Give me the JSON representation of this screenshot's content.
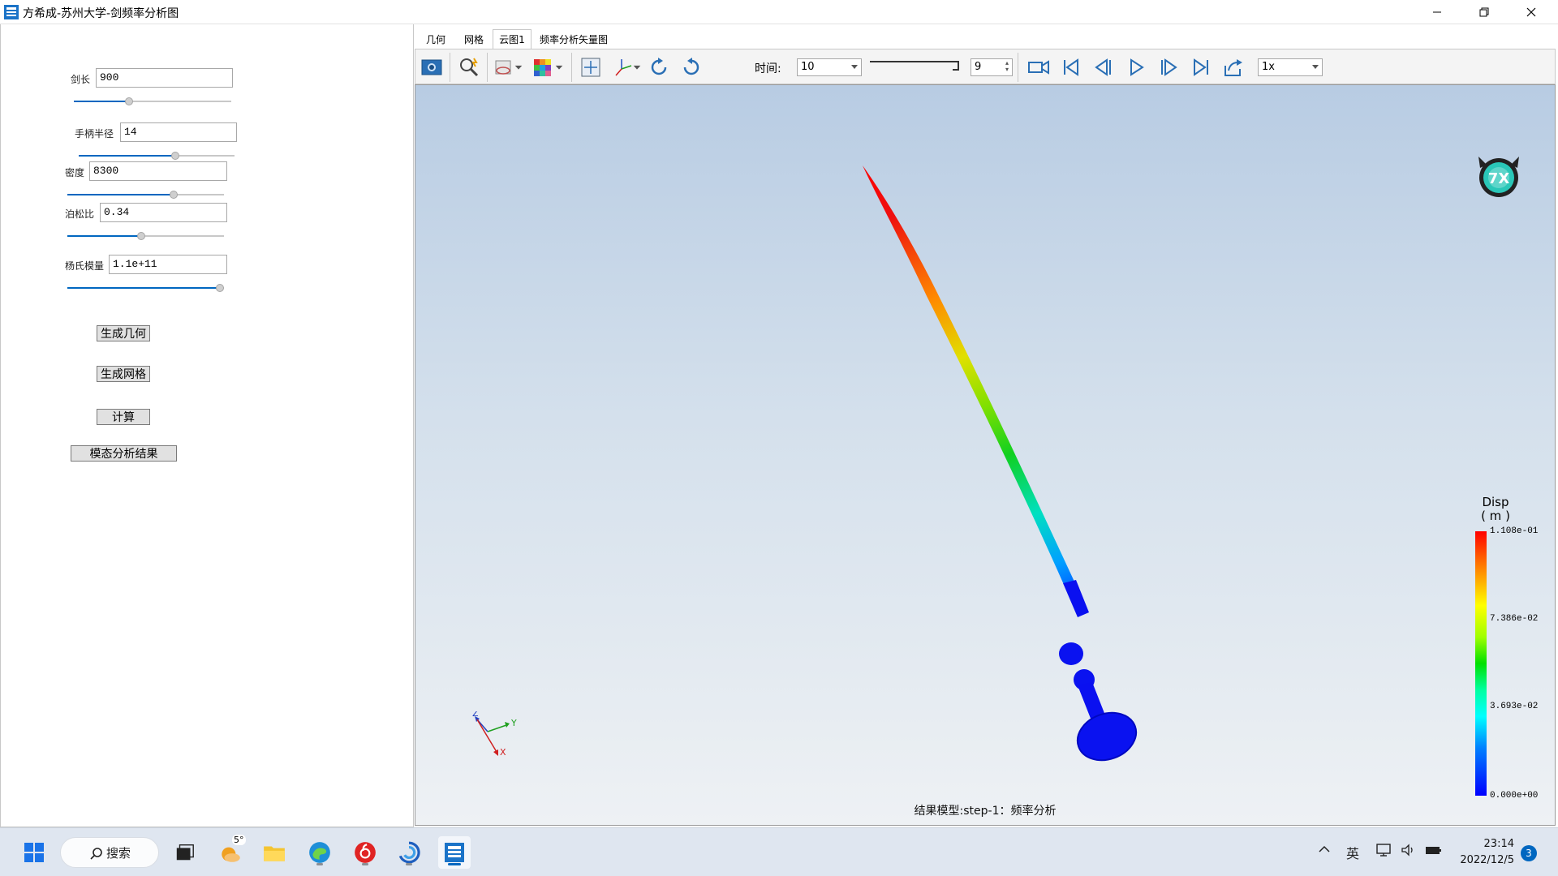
{
  "window": {
    "title": "方希成-苏州大学-剑频率分析图"
  },
  "params": [
    {
      "label": "剑长",
      "value": "900",
      "slider": 0.35
    },
    {
      "label": "手柄半径",
      "value": "14",
      "slider": 0.62
    },
    {
      "label": "密度",
      "value": "8300",
      "slider": 0.68
    },
    {
      "label": "泊松比",
      "value": "0.34",
      "slider": 0.47
    },
    {
      "label": "杨氏模量",
      "value": "1.1e+11",
      "slider": 1.0
    }
  ],
  "buttons": {
    "gen_geometry": "生成几何",
    "gen_mesh": "生成网格",
    "compute": "计算",
    "modal_result": "模态分析结果"
  },
  "tabs": [
    "几何",
    "网格",
    "云图1",
    "频率分析矢量图"
  ],
  "toolbar": {
    "time_label": "时间:",
    "time_value": "10",
    "frame_value": "9",
    "speed_value": "1x"
  },
  "viewport": {
    "result_text": "结果模型:step-1：频率分析",
    "axis_x": "X",
    "axis_y": "Y",
    "axis_z": "Z",
    "legend": {
      "title": "Disp",
      "unit": "( m )",
      "labels": [
        "1.108e-01",
        "7.386e-02",
        "3.693e-02",
        "0.000e+00"
      ]
    }
  },
  "taskbar": {
    "search_label": "搜索",
    "weather_temp": "5°",
    "ime": "英",
    "time": "23:14",
    "date": "2022/12/5",
    "notifications": "3"
  },
  "colors": {
    "accent": "#0067c0",
    "legend_max": "#ff0000",
    "legend_min": "#0000ff"
  }
}
